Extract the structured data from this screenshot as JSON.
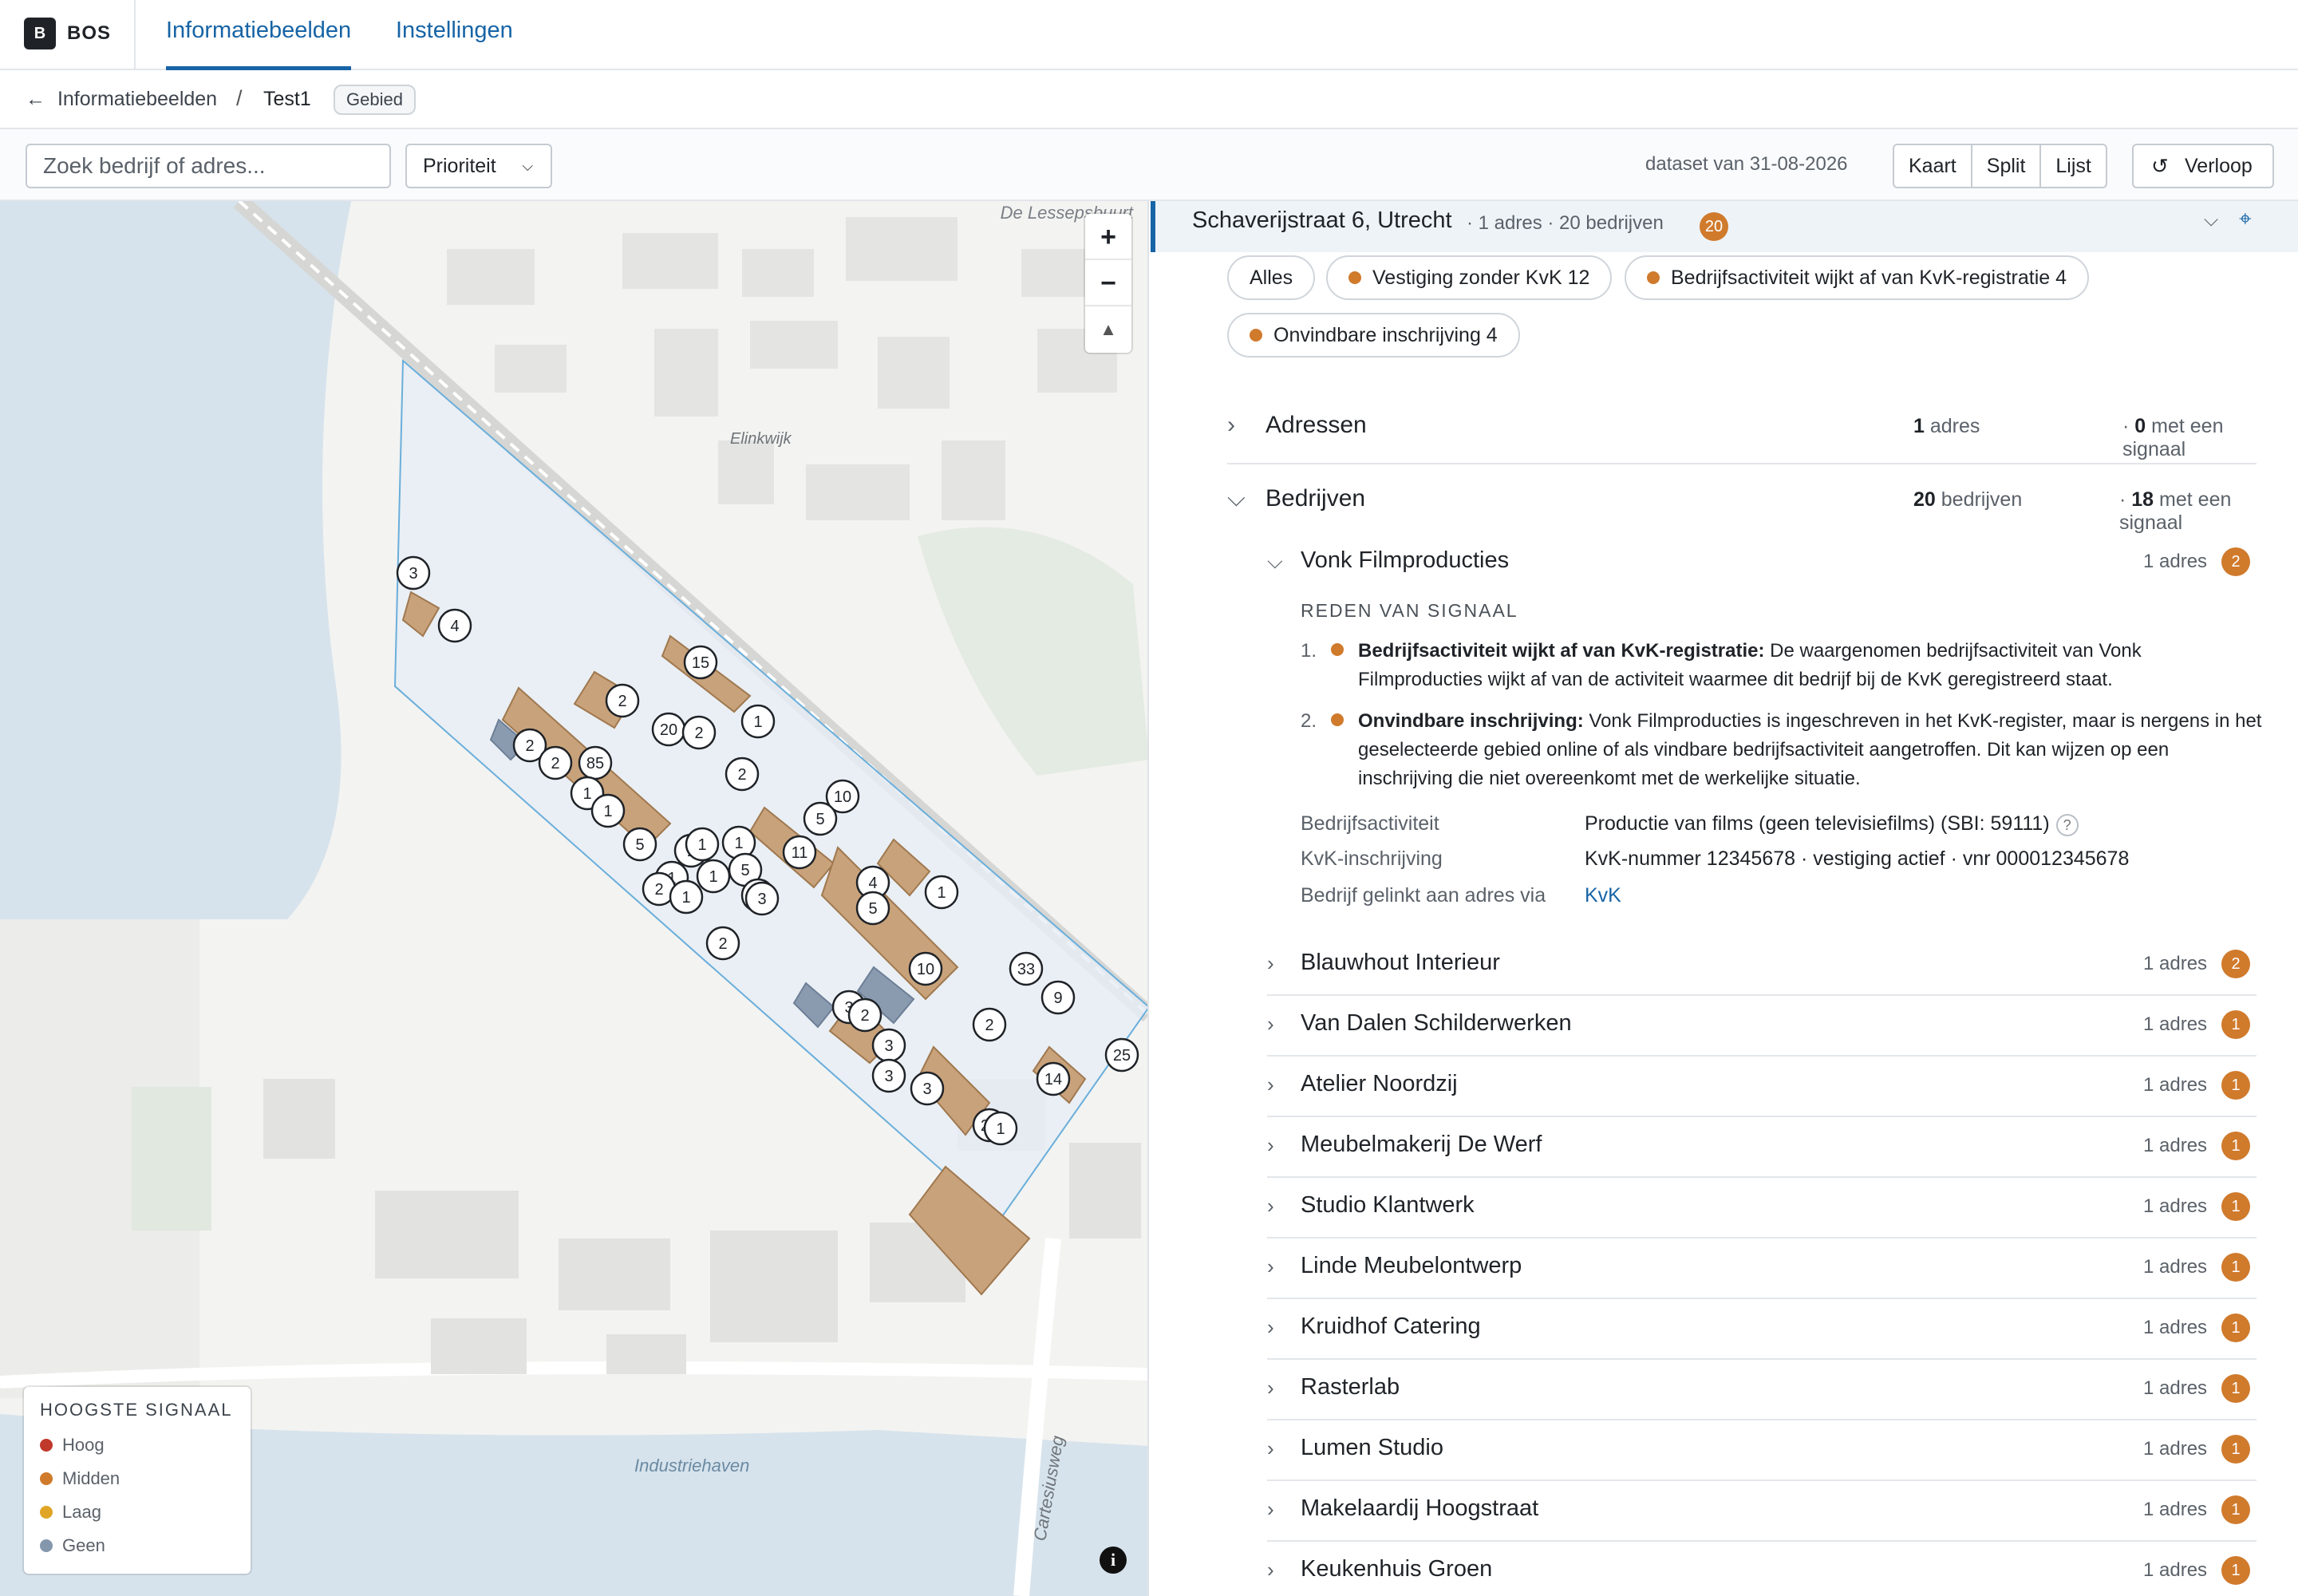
{
  "nav": {
    "logo": "B",
    "brand": "BOS",
    "tabs": [
      "Informatiebeelden",
      "Instellingen"
    ]
  },
  "breadcrumb": {
    "back": "Informatiebeelden",
    "sep": "/",
    "current": "Test1",
    "badge": "Gebied"
  },
  "toolbar": {
    "search_placeholder": "Zoek bedrijf of adres...",
    "priority": "Prioriteit",
    "dataset": "dataset van 31-08-2026",
    "views": [
      "Kaart",
      "Split",
      "Lijst"
    ],
    "history": "Verloop"
  },
  "map": {
    "labels": {
      "top_right": "De Lessepsbuurt",
      "area": "Elinkwijk",
      "harbour": "Industriehaven",
      "street": "Cartesiusweg"
    },
    "markers": [
      "3",
      "4",
      "15",
      "2",
      "20",
      "2",
      "1",
      "2",
      "2",
      "85",
      "1",
      "1",
      "5",
      "2",
      "1",
      "10",
      "5",
      "11",
      "1",
      "1",
      "1",
      "1",
      "2",
      "4",
      "5",
      "1",
      "10",
      "33",
      "9",
      "3",
      "2",
      "2",
      "3",
      "3",
      "3",
      "14",
      "25",
      "1",
      "5",
      "8",
      "23",
      "1",
      "2",
      "3"
    ],
    "legend": {
      "title": "HOOGSTE SIGNAAL",
      "items": [
        {
          "label": "Hoog",
          "color": "#c0392b"
        },
        {
          "label": "Midden",
          "color": "#d07a2c"
        },
        {
          "label": "Laag",
          "color": "#e0a526"
        },
        {
          "label": "Geen",
          "color": "#8497ad"
        }
      ]
    }
  },
  "panel": {
    "address": "Schaverijstraat 6, Utrecht",
    "meta": "· 1 adres · 20 bedrijven",
    "count": "20",
    "filters": [
      "Alles",
      "Vestiging zonder KvK 12",
      "Bedrijfsactiviteit wijkt af van KvK-registratie 4",
      "Onvindbare inschrijving 4"
    ],
    "adressen": {
      "title": "Adressen",
      "count": "1",
      "count_label": "adres",
      "sig": "0",
      "sig_label": "met een signaal",
      "dot": "·"
    },
    "bedrijven": {
      "title": "Bedrijven",
      "count": "20",
      "count_label": "bedrijven",
      "sig": "18",
      "sig_label": "met een signaal",
      "dot": "·"
    },
    "expanded": {
      "name": "Vonk Filmproducties",
      "adres": "1 adres",
      "count": "2",
      "reason_title": "REDEN VAN SIGNAAL",
      "reasons": [
        {
          "num": "1.",
          "title": "Bedrijfsactiviteit wijkt af van KvK-registratie:",
          "text": "De waargenomen bedrijfsactiviteit van Vonk Filmproducties wijkt af van de activiteit waarmee dit bedrijf bij de KvK geregistreerd staat."
        },
        {
          "num": "2.",
          "title": "Onvindbare inschrijving:",
          "text": "Vonk Filmproducties is ingeschreven in het KvK-register, maar is nergens in het geselecteerde gebied online of als vindbare bedrijfsactiviteit aangetroffen. Dit kan wijzen op een inschrijving die niet overeenkomt met de werkelijke situatie."
        }
      ],
      "fields": [
        {
          "k": "Bedrijfsactiviteit",
          "v": "Productie van films (geen televisiefilms) (SBI: 59111)"
        },
        {
          "k": "KvK-inschrijving",
          "v": "KvK-nummer 12345678 · vestiging actief · vnr 000012345678"
        },
        {
          "k": "Bedrijf gelinkt aan adres via",
          "v": "KvK"
        }
      ],
      "help": "?"
    },
    "companies": [
      {
        "name": "Blauwhout Interieur",
        "adres": "1 adres",
        "count": "2"
      },
      {
        "name": "Van Dalen Schilderwerken",
        "adres": "1 adres",
        "count": "1"
      },
      {
        "name": "Atelier Noordzij",
        "adres": "1 adres",
        "count": "1"
      },
      {
        "name": "Meubelmakerij De Werf",
        "adres": "1 adres",
        "count": "1"
      },
      {
        "name": "Studio Klantwerk",
        "adres": "1 adres",
        "count": "1"
      },
      {
        "name": "Linde Meubelontwerp",
        "adres": "1 adres",
        "count": "1"
      },
      {
        "name": "Kruidhof Catering",
        "adres": "1 adres",
        "count": "1"
      },
      {
        "name": "Rasterlab",
        "adres": "1 adres",
        "count": "1"
      },
      {
        "name": "Lumen Studio",
        "adres": "1 adres",
        "count": "1"
      },
      {
        "name": "Makelaardij Hoogstraat",
        "adres": "1 adres",
        "count": "1"
      },
      {
        "name": "Keukenhuis Groen",
        "adres": "1 adres",
        "count": "1"
      }
    ]
  }
}
